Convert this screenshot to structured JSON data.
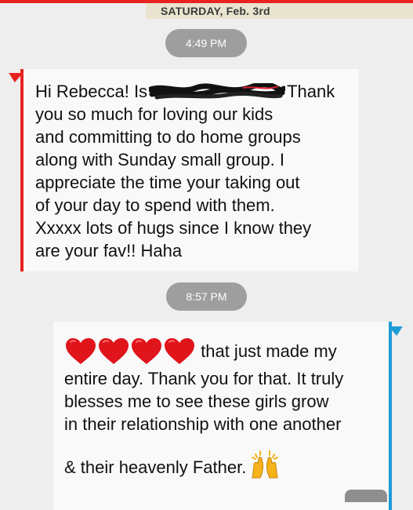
{
  "header": {
    "date": "SATURDAY, Feb. 3rd"
  },
  "messages": [
    {
      "time": "4:49 PM",
      "direction": "incoming",
      "accent_color": "#e8231f",
      "text_prefix": "Hi Rebecca! Is",
      "text_suffix": "Thank",
      "lines": [
        "you so much for loving our kids",
        "and committing to do home groups",
        "along with Sunday small group. I",
        "appreciate the time your taking out",
        "of your day to spend with them.",
        "Xxxxx lots of hugs since I know they",
        "are your fav!! Haha"
      ]
    },
    {
      "time": "8:57 PM",
      "direction": "outgoing",
      "accent_color": "#1e9bd7",
      "emoji_before": "red-heart-emoji x4",
      "first_line_text": "that just made my",
      "lines": [
        "entire day. Thank you for that. It truly",
        "blesses me to see these girls grow",
        "in their relationship with one another"
      ],
      "last_line_text": "& their heavenly Father.",
      "emoji_after": "raising-hands-emoji"
    }
  ]
}
